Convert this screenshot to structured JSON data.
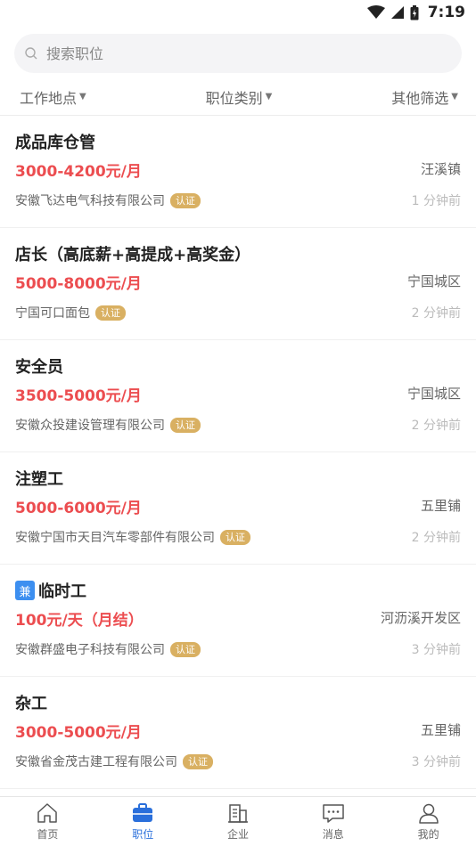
{
  "status": {
    "time": "7:19"
  },
  "search": {
    "placeholder": "搜索职位"
  },
  "filters": [
    {
      "label": "工作地点"
    },
    {
      "label": "职位类别"
    },
    {
      "label": "其他筛选"
    }
  ],
  "jobs": [
    {
      "title": "成品库仓管",
      "tag": "",
      "salary": "3000-4200元/月",
      "location": "汪溪镇",
      "company": "安徽飞达电气科技有限公司",
      "badge": "认证",
      "time": "1 分钟前"
    },
    {
      "title": "店长（高底薪+高提成+高奖金）",
      "tag": "",
      "salary": "5000-8000元/月",
      "location": "宁国城区",
      "company": "宁国可口面包",
      "badge": "认证",
      "time": "2 分钟前"
    },
    {
      "title": "安全员",
      "tag": "",
      "salary": "3500-5000元/月",
      "location": "宁国城区",
      "company": "安徽众投建设管理有限公司",
      "badge": "认证",
      "time": "2 分钟前"
    },
    {
      "title": "注塑工",
      "tag": "",
      "salary": "5000-6000元/月",
      "location": "五里铺",
      "company": "安徽宁国市天目汽车零部件有限公司",
      "badge": "认证",
      "time": "2 分钟前"
    },
    {
      "title": "临时工",
      "tag": "兼",
      "salary": "100元/天（月结）",
      "location": "河沥溪开发区",
      "company": "安徽群盛电子科技有限公司",
      "badge": "认证",
      "time": "3 分钟前"
    },
    {
      "title": "杂工",
      "tag": "",
      "salary": "3000-5000元/月",
      "location": "五里铺",
      "company": "安徽省金茂古建工程有限公司",
      "badge": "认证",
      "time": "3 分钟前"
    }
  ],
  "tabs": [
    {
      "label": "首页"
    },
    {
      "label": "职位"
    },
    {
      "label": "企业"
    },
    {
      "label": "消息"
    },
    {
      "label": "我的"
    }
  ],
  "colors": {
    "accent": "#2a6fdb",
    "salary": "#ec4d50",
    "badge": "#d9b062",
    "part_time_tag": "#3d8ff0"
  }
}
